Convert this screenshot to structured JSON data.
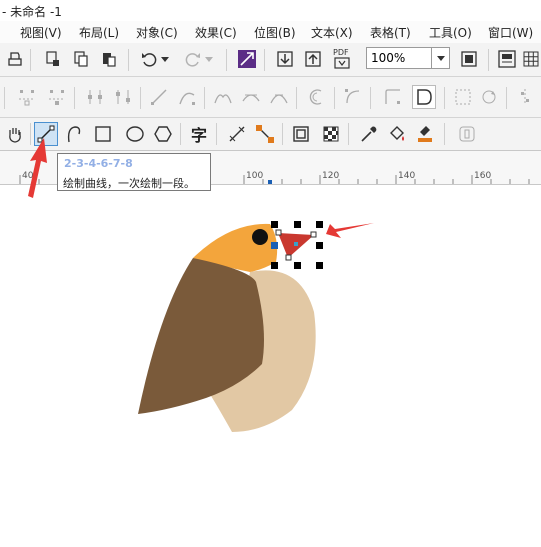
{
  "app": {
    "title": "- 未命名 -1"
  },
  "menu": {
    "items": [
      "视图(V)",
      "布局(L)",
      "对象(C)",
      "效果(C)",
      "位图(B)",
      "文本(X)",
      "表格(T)",
      "工具(O)",
      "窗口(W)"
    ]
  },
  "standard_toolbar": {
    "zoom_value": "100%",
    "pdf_label": "PDF"
  },
  "toolbox": {
    "text_tool_label": "字"
  },
  "ruler": {
    "ticks": [
      "40",
      "100",
      "120",
      "140",
      "160"
    ]
  },
  "tooltip": {
    "title": "2-3-4-6-7-8",
    "text": "绘制曲线，一次绘制一段。"
  },
  "colors": {
    "accent_red": "#e53935",
    "bird_head": "#f3a53c",
    "bird_wing": "#7a5a3a",
    "bird_body": "#e2c8a4",
    "bird_beak": "#c9382f",
    "bird_eye": "#111111",
    "handle_blue": "#1a5fb4"
  }
}
